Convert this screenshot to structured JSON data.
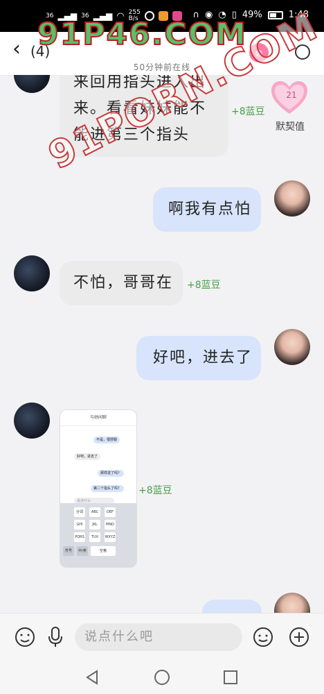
{
  "status_bar": {
    "network_left": "36",
    "network_right": "36",
    "speed": "255\nB/s",
    "battery": "49%",
    "time": "1:48"
  },
  "header": {
    "unread": "(4)",
    "subtitle": "50分钟前在线"
  },
  "messages": [
    {
      "dir": "in",
      "text": "来回用指头进入出\n来。看看妹妹能不\n能进第三个指头",
      "reward": "+8蓝豆"
    },
    {
      "dir": "out",
      "text": "啊我有点怕"
    },
    {
      "dir": "in",
      "text": "不怕，哥哥在",
      "reward": "+8蓝豆"
    },
    {
      "dir": "out",
      "text": "好吧，进去了"
    },
    {
      "dir": "in",
      "type": "image",
      "reward": "+8蓝豆"
    }
  ],
  "side": {
    "intimacy_level": "21",
    "intimacy_label": "默契值"
  },
  "shot": {
    "title": "与她闲聊",
    "lines": [
      "不是，很舒服",
      "好吧，进去了",
      "那样进了吗？",
      "第二个指头了吗？"
    ],
    "input_ph": "说点什么",
    "keys": [
      "分词",
      "ABC",
      "DEF",
      "GHI",
      "JKL",
      "MNO",
      "PQRS",
      "TUV",
      "WXYZ",
      "符号",
      "中/英",
      "空格"
    ]
  },
  "input": {
    "placeholder": "说点什么吧"
  },
  "watermarks": {
    "top": "91P46.COM",
    "middle": "91PORN.COM"
  },
  "colors": {
    "incoming_bubble": "#ebebeb",
    "outgoing_bubble": "#d7e4fb",
    "reward_text": "#4a9f4a",
    "heart": "#f7a8c8"
  }
}
